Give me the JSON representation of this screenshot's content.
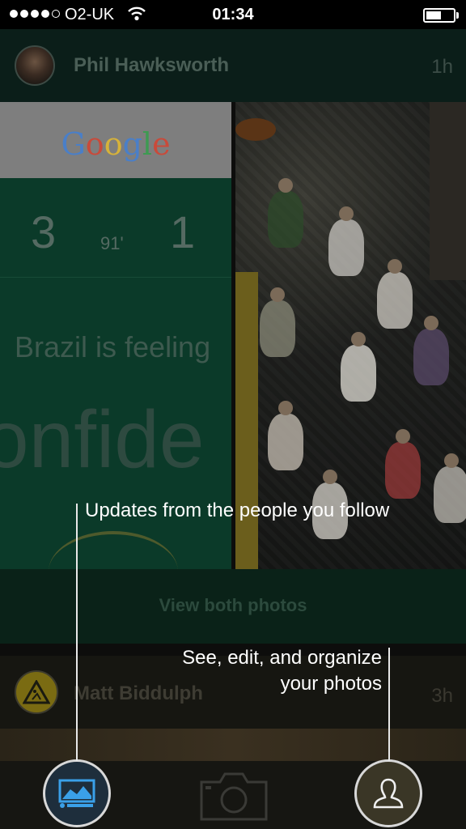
{
  "status_bar": {
    "carrier": "O2-UK",
    "time": "01:34",
    "signal_bars": 4,
    "signal_max": 5,
    "battery_level": 0.55
  },
  "feed": {
    "post1": {
      "author": "Phil Hawksworth",
      "time_ago": "1h",
      "card": {
        "logo_letters": [
          "G",
          "o",
          "o",
          "g",
          "l",
          "e"
        ],
        "logo_colors": [
          "#4a7fc8",
          "#c94a3a",
          "#d6b23a",
          "#4a7fc8",
          "#3e9a52",
          "#c94a3a"
        ],
        "score_left": "3",
        "minute": "91'",
        "score_right": "1",
        "headline": "Brazil is feeling",
        "big_word": "onfide"
      },
      "view_both_label": "View both photos"
    },
    "post2": {
      "author": "Matt Biddulph",
      "time_ago": "3h"
    }
  },
  "tabs": {
    "feed_icon": "photo-feed-icon",
    "camera_icon": "camera-icon",
    "profile_icon": "person-icon"
  },
  "callouts": {
    "feed": "Updates from the people you follow",
    "profile_line1": "See, edit, and organize",
    "profile_line2": "your photos"
  },
  "colors": {
    "accent_blue": "#3aa0e8",
    "callout_line": "#e8e8e8"
  }
}
